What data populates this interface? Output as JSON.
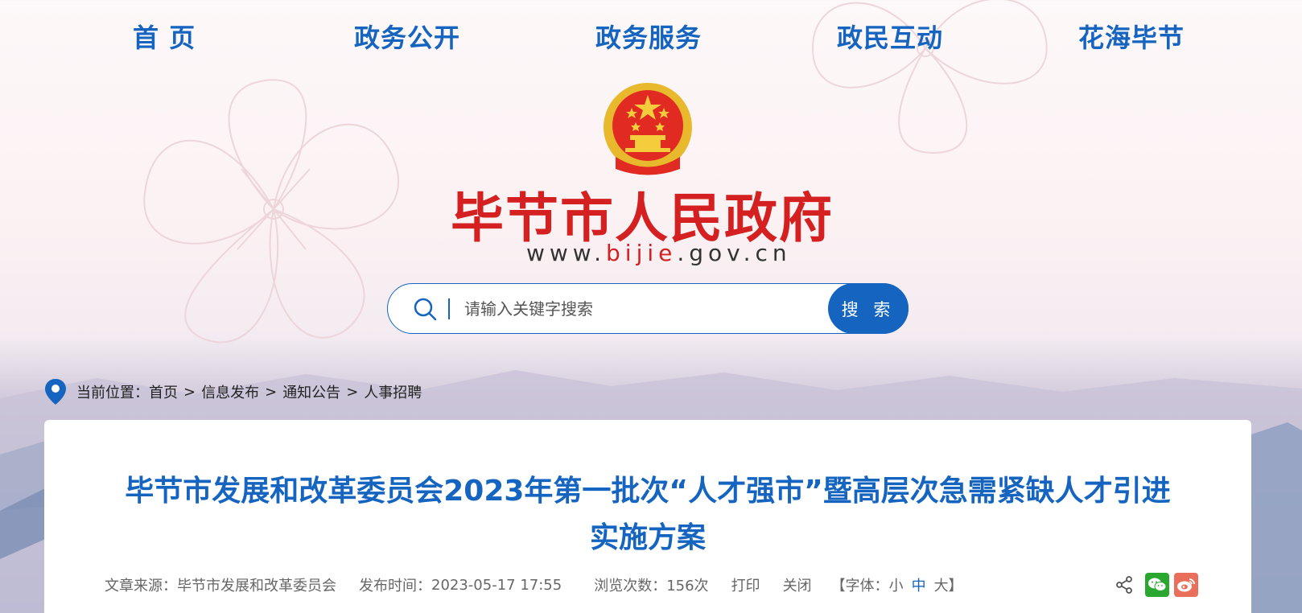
{
  "nav": {
    "items": [
      "首 页",
      "政务公开",
      "政务服务",
      "政民互动",
      "花海毕节"
    ]
  },
  "header": {
    "emblem_icon": "national-emblem-icon",
    "site_title": "毕节市人民政府",
    "url_prefix": "www.",
    "url_highlight": "bijie",
    "url_suffix": ".gov.cn"
  },
  "search": {
    "placeholder": "请输入关键字搜索",
    "button_label": "搜 索",
    "icon": "search-icon"
  },
  "breadcrumb": {
    "prefix": "当前位置：",
    "items": [
      "首页",
      "信息发布",
      "通知公告",
      "人事招聘"
    ],
    "separator": ">",
    "icon": "location-pin-icon"
  },
  "article": {
    "title_line1": "毕节市发展和改革委员会2023年第一批次“人才强市”暨高层次急需紧缺人才引进",
    "title_line2": "实施方案",
    "source_label": "文章来源：",
    "source": "毕节市发展和改革委员会",
    "published_label": "发布时间：",
    "published": "2023-05-17 17:55",
    "views_label": "浏览次数：",
    "views": "156次",
    "print_label": "打印",
    "close_label": "关闭",
    "font_label": "【字体：",
    "font_small": "小",
    "font_mid": "中",
    "font_large": "大】"
  },
  "share": {
    "icons": [
      "share-icon",
      "wechat-icon",
      "weibo-icon"
    ]
  },
  "colors": {
    "primary": "#1565c0",
    "title_red": "#d42020"
  }
}
